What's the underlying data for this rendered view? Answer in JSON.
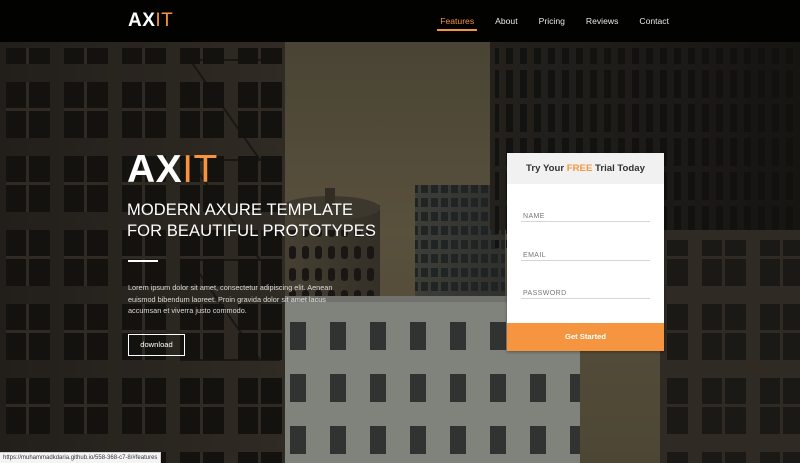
{
  "brand": {
    "logo_main": "AX",
    "logo_accent": "IT"
  },
  "nav": {
    "items": [
      {
        "label": "Features",
        "active": true
      },
      {
        "label": "About",
        "active": false
      },
      {
        "label": "Pricing",
        "active": false
      },
      {
        "label": "Reviews",
        "active": false
      },
      {
        "label": "Contact",
        "active": false
      }
    ]
  },
  "hero": {
    "title_main": "AX",
    "title_accent": "IT",
    "subtitle_line1": "MODERN AXURE TEMPLATE",
    "subtitle_line2": "FOR BEAUTIFUL PROTOTYPES",
    "body": "Lorem ipsum dolor sit amet, consectetur adipiscing elit. Aenean euismod bibendum laoreet. Proin gravida dolor sit amet lacus accumsan et viverra justo commodo.",
    "button_label": "download"
  },
  "signup": {
    "title_prefix": "Try Your ",
    "title_highlight": "FREE",
    "title_suffix": " Trial Today",
    "name_placeholder": "NAME",
    "email_placeholder": "EMAIL",
    "password_placeholder": "PASSWORD",
    "submit_label": "Get Started"
  },
  "status_bar": {
    "url": "https://muhammadkdaria.github.io/558-368-c7-8/#features"
  },
  "colors": {
    "accent": "#f6953f",
    "topbar": "#000000",
    "card_header": "#f1f1f1"
  }
}
